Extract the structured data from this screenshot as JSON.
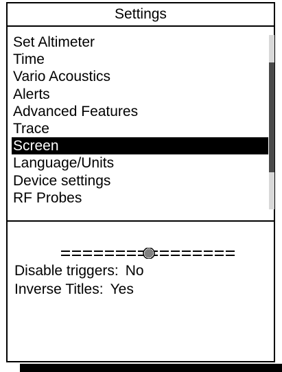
{
  "title": "Settings",
  "menu": {
    "items": [
      {
        "label": "Set Altimeter"
      },
      {
        "label": "Time"
      },
      {
        "label": "Vario Acoustics"
      },
      {
        "label": "Alerts"
      },
      {
        "label": "Advanced Features"
      },
      {
        "label": "Trace"
      },
      {
        "label": "Screen"
      },
      {
        "label": "Language/Units"
      },
      {
        "label": "Device settings"
      },
      {
        "label": "RF Probes"
      }
    ],
    "selected_label": "Screen"
  },
  "slider": {
    "value_fraction": 0.5
  },
  "settings": {
    "disable_triggers": {
      "label": "Disable triggers:",
      "value": "No"
    },
    "inverse_titles": {
      "label": "Inverse Titles:",
      "value": "Yes"
    }
  },
  "colors": {
    "foreground": "#000000",
    "background": "#ffffff",
    "scrollbar_track": "#d8d8d8",
    "scrollbar_thumb": "#4a4a4a"
  }
}
